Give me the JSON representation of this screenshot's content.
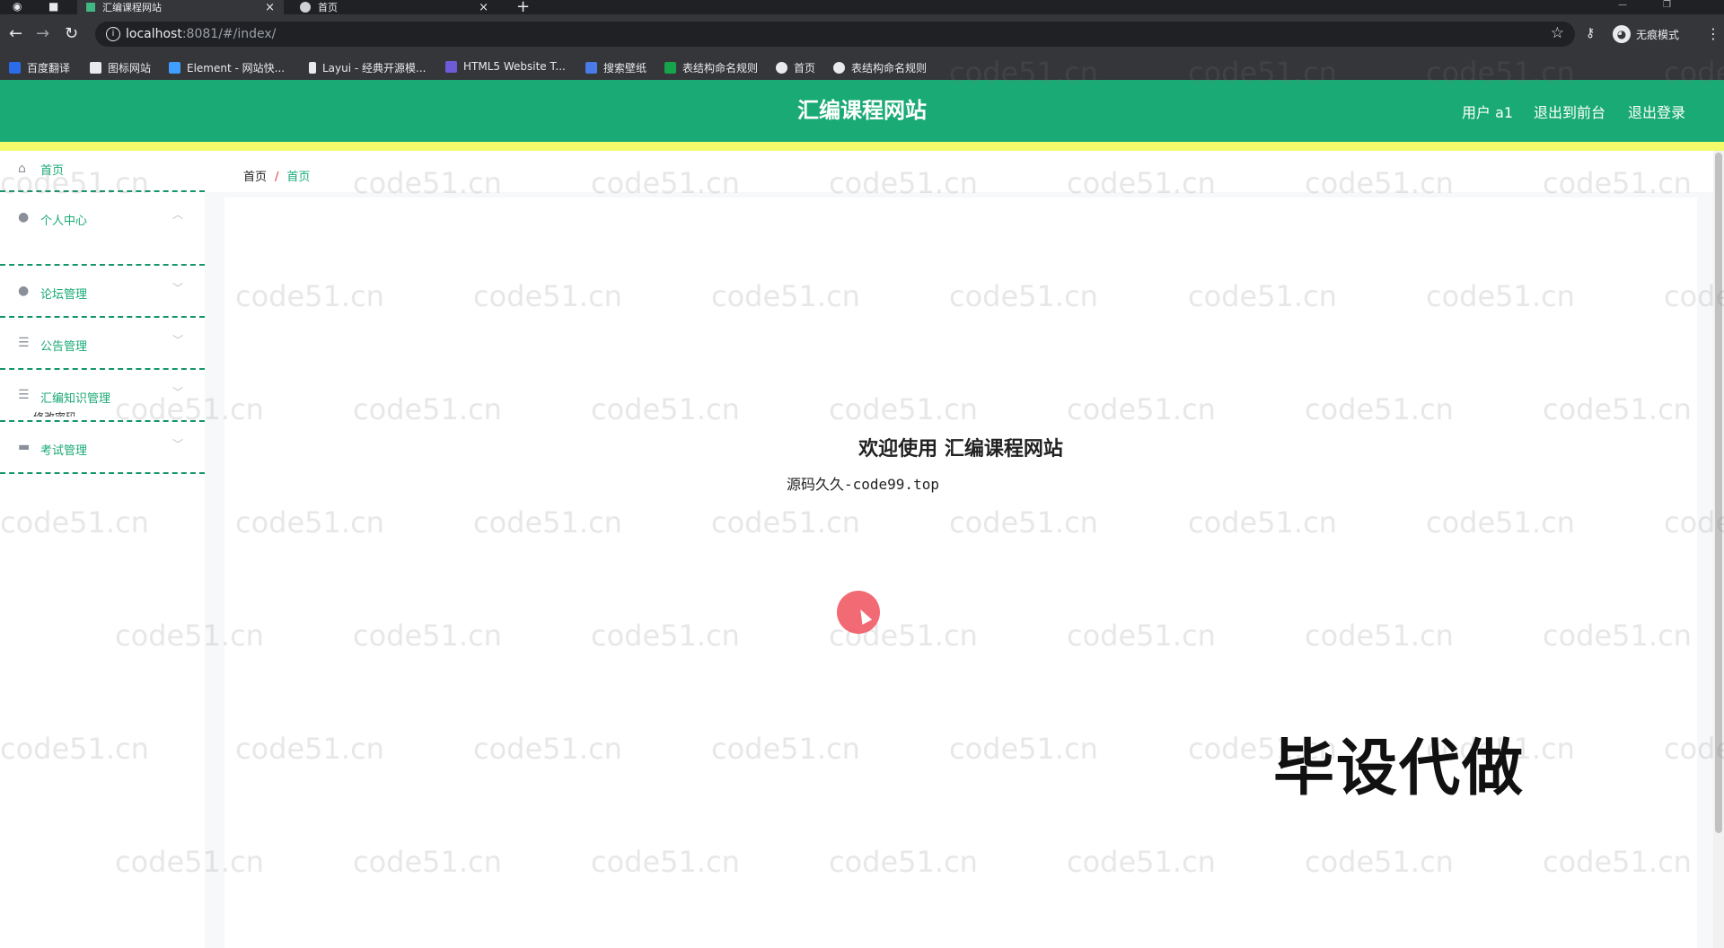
{
  "browser": {
    "tabs": [
      {
        "title": "汇编课程网站",
        "active": true
      },
      {
        "title": "首页",
        "active": false
      }
    ],
    "url_host": "localhost",
    "url_rest": ":8081/#/index/",
    "profile_label": "无痕模式",
    "bookmarks": [
      {
        "label": "百度翻译",
        "color": "#2b6de8"
      },
      {
        "label": "图标网站",
        "color": "#e8eaed"
      },
      {
        "label": "Element - 网站快...",
        "color": "#409eff"
      },
      {
        "label": "Layui - 经典开源模...",
        "color": "#e8eaed"
      },
      {
        "label": "HTML5 Website T...",
        "color": "#6f5bd8"
      },
      {
        "label": "搜索壁纸",
        "color": "#4a7be8"
      },
      {
        "label": "表结构命名规则",
        "color": "#16a34a"
      },
      {
        "label": "首页",
        "color": "#e8eaed"
      },
      {
        "label": "表结构命名规则",
        "color": "#e8eaed"
      }
    ]
  },
  "header": {
    "title": "汇编课程网站",
    "user_label": "用户 a1",
    "front_label": "退出到前台",
    "logout_label": "退出登录"
  },
  "sidebar": {
    "items": [
      {
        "label": "首页",
        "icon": "home-icon",
        "glyph": "⌂"
      },
      {
        "label": "个人中心",
        "icon": "user-icon",
        "glyph": "●"
      },
      {
        "label": "论坛管理",
        "icon": "user-icon",
        "glyph": "●"
      },
      {
        "label": "公告管理",
        "icon": "list-icon",
        "glyph": "☰"
      },
      {
        "label": "汇编知识管理",
        "icon": "list-icon",
        "glyph": "☰"
      },
      {
        "label": "考试管理",
        "icon": "ticket-icon",
        "glyph": "▬"
      }
    ],
    "stray_text": "修改密码"
  },
  "breadcrumb": {
    "home": "首页",
    "separator": "/",
    "current": "首页"
  },
  "main": {
    "welcome": "欢迎使用 汇编课程网站",
    "subline": "源码久久-code99.top"
  },
  "overlay": {
    "badge": "毕设代做",
    "watermark": "code51.cn"
  }
}
